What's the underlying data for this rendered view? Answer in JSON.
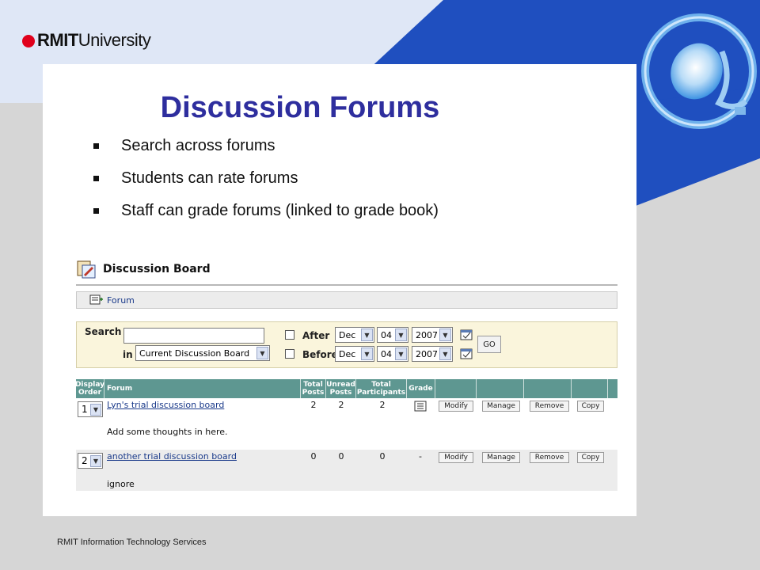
{
  "brand": {
    "logo_name": "RMIT",
    "logo_suffix": "University"
  },
  "slide": {
    "title": "Discussion Forums",
    "bullets": [
      "Search across forums",
      "Students can rate forums",
      "Staff can grade forums (linked to grade book)"
    ],
    "footer": "RMIT Information Technology Services"
  },
  "screenshot": {
    "page_title": "Discussion Board",
    "action_button": "Forum",
    "search": {
      "search_label": "Search",
      "in_label": "in",
      "search_value": "",
      "scope_value": "Current Discussion Board",
      "after_label": "After",
      "before_label": "Before",
      "after": {
        "month": "Dec",
        "day": "04",
        "year": "2007"
      },
      "before": {
        "month": "Dec",
        "day": "04",
        "year": "2007"
      },
      "go_label": "GO"
    },
    "table": {
      "headers": {
        "display_order": "Display Order",
        "forum": "Forum",
        "total_posts": "Total Posts",
        "unread_posts": "Unread Posts",
        "total_participants": "Total Participants",
        "grade": "Grade"
      },
      "rows": [
        {
          "order": "1",
          "name": "Lyn's trial discussion board",
          "description": "Add some thoughts in here.",
          "total_posts": "2",
          "unread_posts": "2",
          "participants": "2",
          "grade": "",
          "modify": "Modify",
          "manage": "Manage",
          "remove": "Remove",
          "copy": "Copy"
        },
        {
          "order": "2",
          "name": "another trial discussion board",
          "description": "ignore",
          "total_posts": "0",
          "unread_posts": "0",
          "participants": "0",
          "grade": "-",
          "modify": "Modify",
          "manage": "Manage",
          "remove": "Remove",
          "copy": "Copy"
        }
      ]
    }
  },
  "colors": {
    "brand_blue": "#1f4fbf",
    "title_color": "#2e2e9e",
    "table_header": "#5e9791",
    "search_bg": "#faf5dc",
    "link": "#1a3a8a"
  }
}
